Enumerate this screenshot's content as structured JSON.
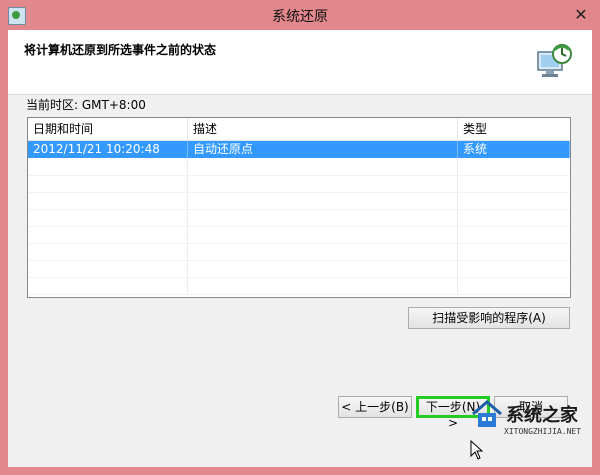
{
  "window": {
    "title": "系统还原",
    "close_glyph": "✕"
  },
  "header": {
    "heading": "将计算机还原到所选事件之前的状态",
    "icon": "system-restore-icon"
  },
  "timezone": "当前时区: GMT+8:00",
  "list": {
    "columns": [
      "日期和时间",
      "描述",
      "类型"
    ],
    "rows": [
      {
        "datetime": "2012/11/21 10:20:48",
        "description": "自动还原点",
        "type": "系统",
        "selected": true
      }
    ]
  },
  "buttons": {
    "scan": "扫描受影响的程序(A)",
    "back": "< 上一步(B)",
    "next": "下一步(N) >",
    "cancel": "取消"
  },
  "watermark": {
    "text": "系统之家",
    "url": "XITONGZHIJIA.NET"
  },
  "colors": {
    "titlebar": "#e2888c",
    "selection": "#3399ff",
    "highlight": "#22cc22"
  }
}
